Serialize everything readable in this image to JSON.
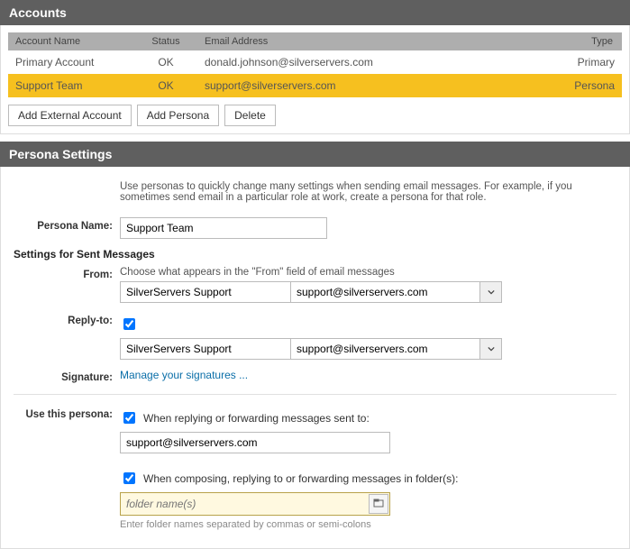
{
  "accounts": {
    "title": "Accounts",
    "columns": {
      "name": "Account Name",
      "status": "Status",
      "email": "Email Address",
      "type": "Type"
    },
    "rows": [
      {
        "name": "Primary Account",
        "status": "OK",
        "email": "donald.johnson@silverservers.com",
        "type": "Primary",
        "selected": false
      },
      {
        "name": "Support Team",
        "status": "OK",
        "email": "support@silverservers.com",
        "type": "Persona",
        "selected": true
      }
    ],
    "buttons": {
      "add_external": "Add External Account",
      "add_persona": "Add Persona",
      "delete": "Delete"
    }
  },
  "persona": {
    "title": "Persona Settings",
    "intro": "Use personas to quickly change many settings when sending email messages. For example, if you sometimes send email in a particular role at work, create a persona for that role.",
    "name_label": "Persona Name:",
    "name_value": "Support Team",
    "sent_title": "Settings for Sent Messages",
    "from_label": "From:",
    "from_hint": "Choose what appears in the \"From\" field of email messages",
    "from_name": "SilverServers Support",
    "from_email": "support@silverservers.com",
    "replyto_label": "Reply-to:",
    "replyto_checked": true,
    "replyto_name": "SilverServers Support",
    "replyto_email": "support@silverservers.com",
    "signature_label": "Signature:",
    "signature_link": "Manage your signatures ...",
    "use_label": "Use this persona:",
    "use_reply_check_label": "When replying or forwarding messages sent to:",
    "use_reply_value": "support@silverservers.com",
    "use_folder_check_label": "When composing, replying to or forwarding messages in folder(s):",
    "folder_placeholder": "folder name(s)",
    "folder_hint": "Enter folder names separated by commas or semi-colons"
  }
}
